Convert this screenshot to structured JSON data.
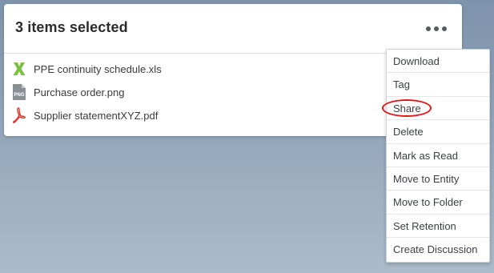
{
  "selection": {
    "title": "3 items selected",
    "more_icon": "ellipsis-horizontal-icon"
  },
  "files": [
    {
      "name": "PPE continuity schedule.xls",
      "icon": "excel-icon",
      "icon_color": "#7ac143"
    },
    {
      "name": "Purchase order.png",
      "icon": "png-file-icon",
      "icon_color": "#8a8f94"
    },
    {
      "name": "Supplier statementXYZ.pdf",
      "icon": "pdf-icon",
      "icon_color": "#d9342b"
    }
  ],
  "menu": {
    "items": [
      {
        "label": "Download"
      },
      {
        "label": "Tag"
      },
      {
        "label": "Share",
        "highlighted": true
      },
      {
        "label": "Delete"
      },
      {
        "label": "Mark as Read"
      },
      {
        "label": "Move to Entity"
      },
      {
        "label": "Move to Folder"
      },
      {
        "label": "Set Retention"
      },
      {
        "label": "Create Discussion"
      }
    ]
  },
  "colors": {
    "highlight": "#e01818",
    "background_top": "#7d93ab",
    "background_bottom": "#abbbca"
  }
}
